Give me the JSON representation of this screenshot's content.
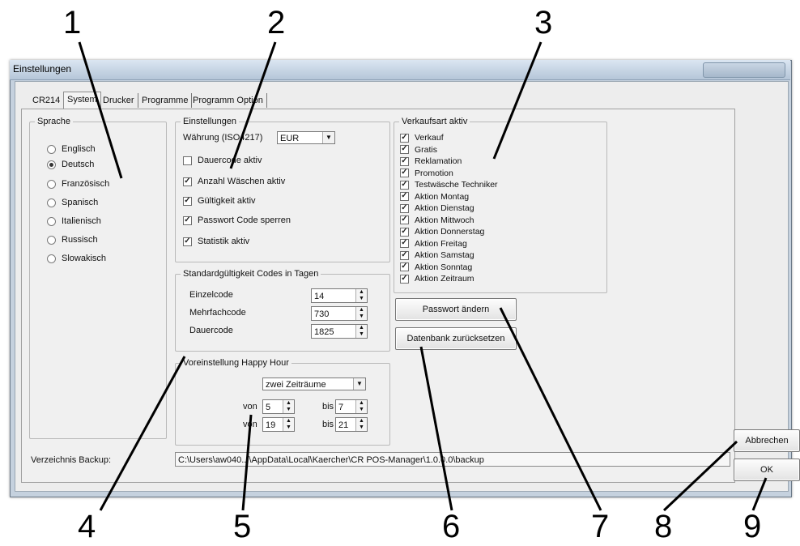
{
  "window": {
    "title": "Einstellungen"
  },
  "tabs": [
    {
      "label": "CR214"
    },
    {
      "label": "System"
    },
    {
      "label": "Drucker"
    },
    {
      "label": "Programme"
    },
    {
      "label": "Programm Option"
    }
  ],
  "sprache": {
    "legend": "Sprache",
    "options": [
      "Englisch",
      "Deutsch",
      "Französisch",
      "Spanisch",
      "Italienisch",
      "Russisch",
      "Slowakisch"
    ],
    "selected": "Deutsch"
  },
  "einstellungen": {
    "legend": "Einstellungen",
    "currency_label": "Währung (ISO4217)",
    "currency_value": "EUR",
    "checks": [
      {
        "label": "Dauercode aktiv",
        "checked": false
      },
      {
        "label": "Anzahl Wäschen aktiv",
        "checked": true
      },
      {
        "label": "Gültigkeit aktiv",
        "checked": true
      },
      {
        "label": "Passwort Code sperren",
        "checked": true
      },
      {
        "label": "Statistik aktiv",
        "checked": true
      }
    ]
  },
  "standard": {
    "legend": "Standardgültigkeit Codes in Tagen",
    "rows": [
      {
        "label": "Einzelcode",
        "value": "14"
      },
      {
        "label": "Mehrfachcode",
        "value": "730"
      },
      {
        "label": "Dauercode",
        "value": "1825"
      }
    ]
  },
  "happy_hour": {
    "legend": "Voreinstellung Happy Hour",
    "mode": "zwei Zeiträume",
    "von_label": "von",
    "bis_label": "bis",
    "rows": [
      {
        "von": "5",
        "bis": "7"
      },
      {
        "von": "19",
        "bis": "21"
      }
    ]
  },
  "verkaufsart": {
    "legend": "Verkaufsart aktiv",
    "items": [
      "Verkauf",
      "Gratis",
      "Reklamation",
      "Promotion",
      "Testwäsche Techniker",
      "Aktion Montag",
      "Aktion Dienstag",
      "Aktion Mittwoch",
      "Aktion Donnerstag",
      "Aktion Freitag",
      "Aktion Samstag",
      "Aktion Sonntag",
      "Aktion Zeitraum"
    ]
  },
  "buttons": {
    "password": "Passwort ändern",
    "reset_db": "Datenbank zurücksetzen",
    "cancel": "Abbrechen",
    "ok": "OK"
  },
  "backup": {
    "label": "Verzeichnis Backup:",
    "path": "C:\\Users\\aw040...\\AppData\\Local\\Kaercher\\CR POS-Manager\\1.0.0.0\\backup"
  },
  "callouts": [
    "1",
    "2",
    "3",
    "4",
    "5",
    "6",
    "7",
    "8",
    "9"
  ]
}
